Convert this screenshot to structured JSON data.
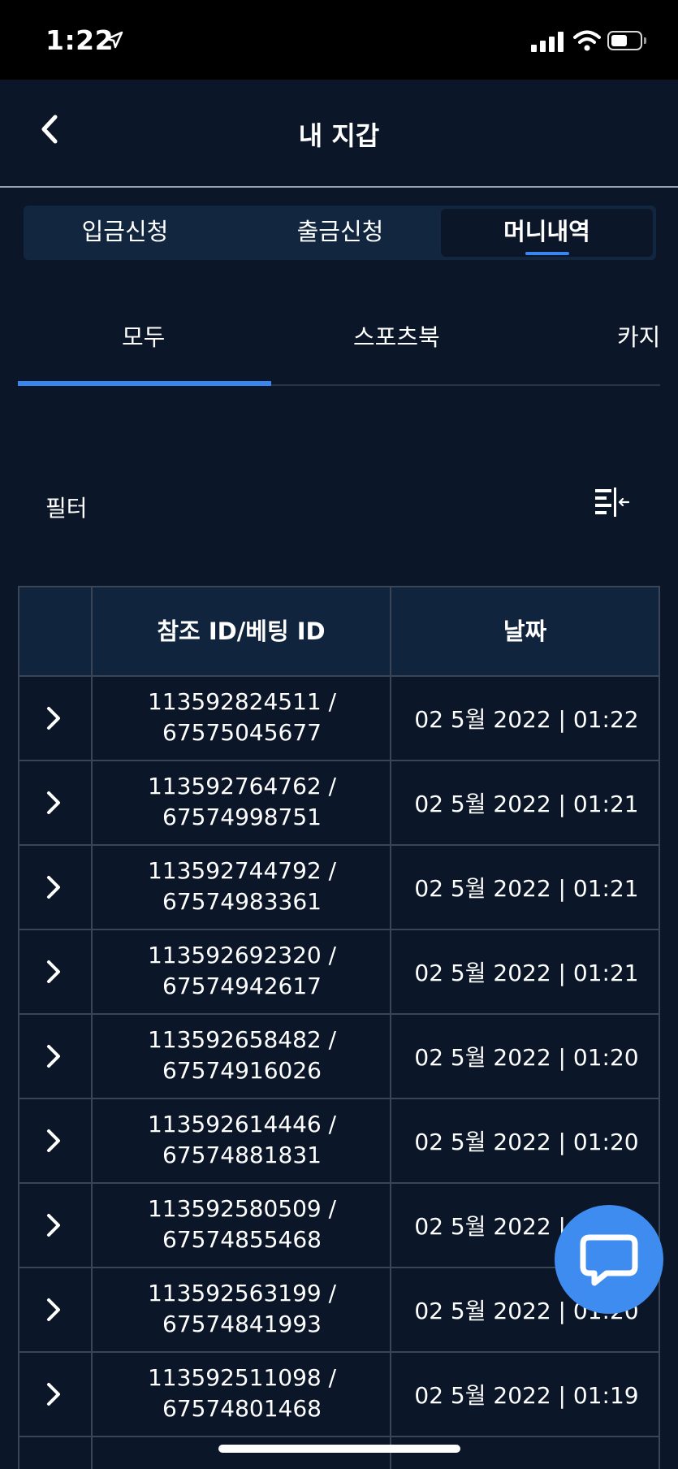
{
  "status_bar": {
    "time": "1:22"
  },
  "header": {
    "title": "내 지갑"
  },
  "segment_tabs": [
    {
      "label": "입금신청",
      "active": false
    },
    {
      "label": "출금신청",
      "active": false
    },
    {
      "label": "머니내역",
      "active": true
    }
  ],
  "category_tabs": [
    {
      "label": "모두",
      "active": true
    },
    {
      "label": "스포츠북",
      "active": false
    },
    {
      "label": "카지",
      "active": false
    }
  ],
  "filter": {
    "label": "필터"
  },
  "table": {
    "columns": [
      "",
      "참조 ID/베팅 ID",
      "날짜"
    ],
    "rows": [
      {
        "ref": "113592824511 /",
        "bet": "67575045677",
        "date": "02 5월 2022 | 01:22"
      },
      {
        "ref": "113592764762 /",
        "bet": "67574998751",
        "date": "02 5월 2022 | 01:21"
      },
      {
        "ref": "113592744792 /",
        "bet": "67574983361",
        "date": "02 5월 2022 | 01:21"
      },
      {
        "ref": "113592692320 /",
        "bet": "67574942617",
        "date": "02 5월 2022 | 01:21"
      },
      {
        "ref": "113592658482 /",
        "bet": "67574916026",
        "date": "02 5월 2022 | 01:20"
      },
      {
        "ref": "113592614446 /",
        "bet": "67574881831",
        "date": "02 5월 2022 | 01:20"
      },
      {
        "ref": "113592580509 /",
        "bet": "67574855468",
        "date": "02 5월 2022 | 01:20"
      },
      {
        "ref": "113592563199 /",
        "bet": "67574841993",
        "date": "02 5월 2022 | 01:20"
      },
      {
        "ref": "113592511098 /",
        "bet": "67574801468",
        "date": "02 5월 2022 | 01:19"
      }
    ]
  },
  "colors": {
    "background": "#0b1628",
    "accent": "#3a86f0",
    "header_row": "#11243e",
    "chat_button": "#3f8cf0"
  },
  "icons": [
    "location-arrow-icon",
    "signal-icon",
    "wifi-icon",
    "battery-icon",
    "back-chevron-icon",
    "filter-sort-icon",
    "chevron-right-icon",
    "chat-bubble-icon"
  ]
}
